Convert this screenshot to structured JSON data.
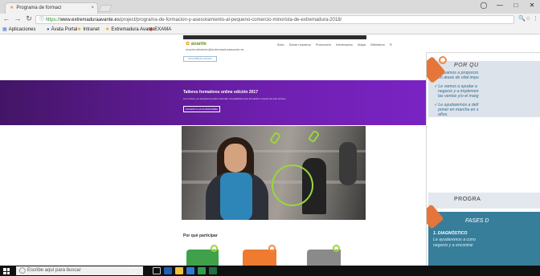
{
  "browser": {
    "tab_title": "Programa de formaci",
    "tab_close": "×",
    "url_prefix": "https://",
    "url_host": "www.extremaduraavante.es",
    "url_path": "/project/programa-de-formacion-y-asesoramiento-al-pequeno-comercio-minorista-de-extremadura-2018/",
    "bookmarks": [
      "Aplicaciones",
      "Ávata Portal",
      "Intranet",
      "Extremadura Avante",
      "EXAMA"
    ]
  },
  "page": {
    "nav_items": [
      "Área",
      "Sobre nosotros",
      "Promoción",
      "Información",
      "Mapa",
      "Biblioteca"
    ],
    "email": "emprendimiento@extremaduraavante.es",
    "info_button": "INSCRÍBETE AHORA",
    "banner": {
      "title": "Talleres formativos online edición 2017",
      "subtitle": "Los cursos y el programa pueden acceder a la plataforma de formación a través de este acceso.",
      "button": "ACCESO A LA PLATAFORMA"
    },
    "why_title": "Por qué participar"
  },
  "infographic": {
    "pq_title": "POR QU",
    "bullets": [
      [
        "Le vamos a proporcio",
        "en áreas de vital impo"
      ],
      [
        "Le vamos a ayudar a ",
        "negocio y a implemen",
        "las ventas y/o el marg"
      ],
      [
        "Le ayudaremos a defi",
        "poner en marcha en s",
        "años."
      ]
    ],
    "program_title": "PROGRA",
    "fases_title": "FASES D",
    "diag_title": "1. DIAGNÓSTICO",
    "diag_lines": [
      "Le ayudaremos a cono",
      "negocio y a encontrar"
    ]
  },
  "taskbar": {
    "search_placeholder": "Escribe aquí para buscar"
  }
}
